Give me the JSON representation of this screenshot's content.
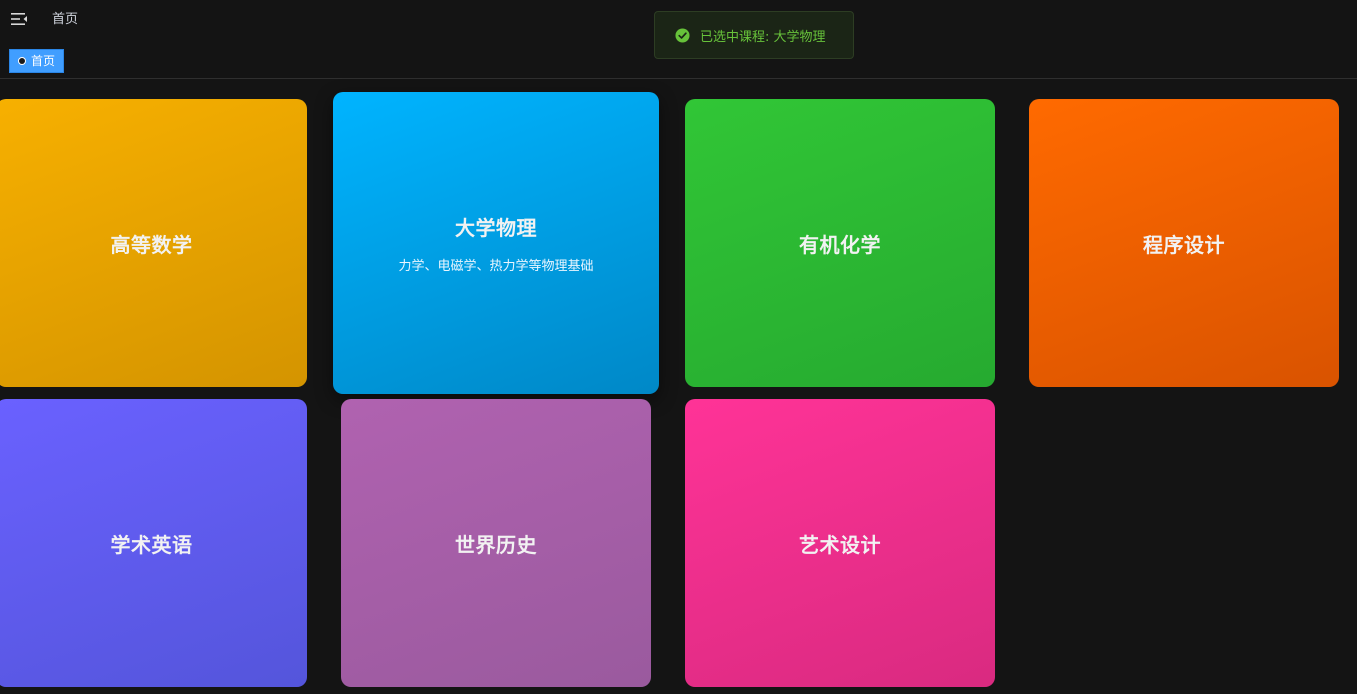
{
  "header": {
    "menu_icon": "menu-fold-icon",
    "breadcrumb": "首页"
  },
  "tags": [
    {
      "label": "首页",
      "active": true
    }
  ],
  "toast": {
    "icon": "check-circle-icon",
    "message": "已选中课程: 大学物理",
    "color": "#67c23a"
  },
  "courses": [
    {
      "title": "高等数学",
      "description": "",
      "colors": [
        "#f7b000",
        "#d49400"
      ]
    },
    {
      "title": "大学物理",
      "description": "力学、电磁学、热力学等物理基础",
      "colors": [
        "#00b4ff",
        "#0088c7"
      ],
      "selected": true
    },
    {
      "title": "有机化学",
      "description": "",
      "colors": [
        "#31c636",
        "#26aa30"
      ]
    },
    {
      "title": "程序设计",
      "description": "",
      "colors": [
        "#ff6a00",
        "#d95300"
      ]
    },
    {
      "title": "学术英语",
      "description": "",
      "colors": [
        "#6a61ff",
        "#5455db"
      ]
    },
    {
      "title": "世界历史",
      "description": "",
      "colors": [
        "#b062b0",
        "#9a5a9e"
      ]
    },
    {
      "title": "艺术设计",
      "description": "",
      "colors": [
        "#ff3397",
        "#d92a80"
      ]
    }
  ]
}
